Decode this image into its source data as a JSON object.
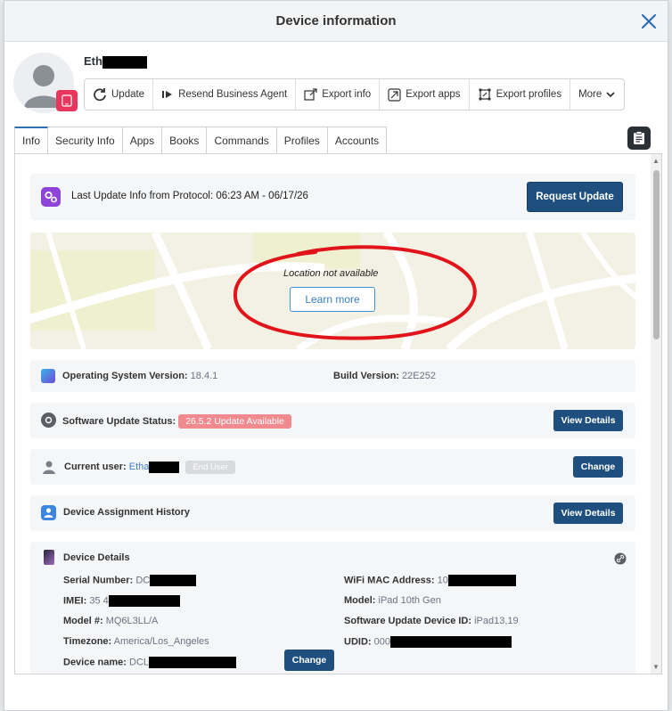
{
  "modal": {
    "title": "Device information"
  },
  "device": {
    "name_prefix": "Eth"
  },
  "toolbar": {
    "update": "Update",
    "resend_agent": "Resend Business Agent",
    "export_info": "Export info",
    "export_apps": "Export apps",
    "export_profiles": "Export profiles",
    "more": "More"
  },
  "tabs": [
    {
      "label": "Info"
    },
    {
      "label": "Security Info"
    },
    {
      "label": "Apps"
    },
    {
      "label": "Books"
    },
    {
      "label": "Commands"
    },
    {
      "label": "Profiles"
    },
    {
      "label": "Accounts"
    }
  ],
  "last_update": {
    "label": "Last Update Info from Protocol: 06:23 AM - 06/17/26",
    "button": "Request Update"
  },
  "location": {
    "message": "Location not available",
    "button": "Learn more"
  },
  "os": {
    "label": "Operating System Version:",
    "value": "18.4.1",
    "build_label": "Build Version:",
    "build_value": "22E252"
  },
  "software_update": {
    "label": "Software Update Status:",
    "badge": "26.5.2 Update Available",
    "button": "View Details"
  },
  "current_user": {
    "label": "Current user:",
    "value_prefix": "Etha",
    "role": "End User",
    "button": "Change"
  },
  "assignment": {
    "label": "Device Assignment History",
    "button": "View Details"
  },
  "details": {
    "title": "Device Details",
    "serial_label": "Serial Number:",
    "serial_prefix": "DC",
    "imei_label": "IMEI:",
    "imei_prefix": "35 4",
    "model_no_label": "Model #:",
    "model_no": "MQ6L3LL/A",
    "timezone_label": "Timezone:",
    "timezone": "America/Los_Angeles",
    "device_name_label": "Device name:",
    "device_name_prefix": "DCL",
    "change_button": "Change",
    "wifi_label": "WiFi MAC Address:",
    "wifi_prefix": "10",
    "model_label": "Model:",
    "model": "iPad 10th Gen",
    "sw_device_id_label": "Software Update Device ID:",
    "sw_device_id": "iPad13,19",
    "udid_label": "UDID:",
    "udid_prefix": "000"
  },
  "colors": {
    "primary": "#1e4f7e",
    "badge": "#f08a8e",
    "annotation": "#e0141a",
    "accent": "#2f6fb5"
  }
}
